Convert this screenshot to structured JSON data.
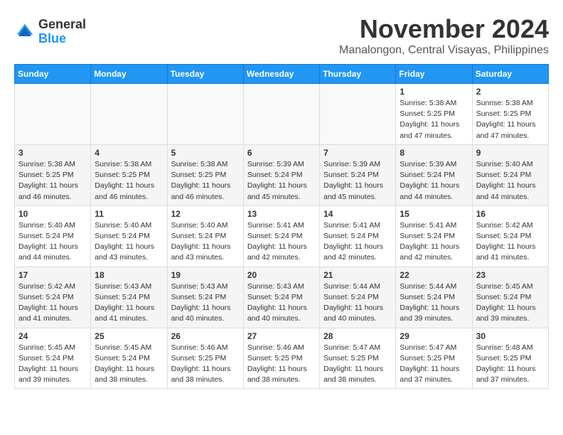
{
  "header": {
    "logo_general": "General",
    "logo_blue": "Blue",
    "month_title": "November 2024",
    "location": "Manalongon, Central Visayas, Philippines"
  },
  "weekdays": [
    "Sunday",
    "Monday",
    "Tuesday",
    "Wednesday",
    "Thursday",
    "Friday",
    "Saturday"
  ],
  "weeks": [
    [
      {
        "day": "",
        "info": ""
      },
      {
        "day": "",
        "info": ""
      },
      {
        "day": "",
        "info": ""
      },
      {
        "day": "",
        "info": ""
      },
      {
        "day": "",
        "info": ""
      },
      {
        "day": "1",
        "info": "Sunrise: 5:38 AM\nSunset: 5:25 PM\nDaylight: 11 hours and 47 minutes."
      },
      {
        "day": "2",
        "info": "Sunrise: 5:38 AM\nSunset: 5:25 PM\nDaylight: 11 hours and 47 minutes."
      }
    ],
    [
      {
        "day": "3",
        "info": "Sunrise: 5:38 AM\nSunset: 5:25 PM\nDaylight: 11 hours and 46 minutes."
      },
      {
        "day": "4",
        "info": "Sunrise: 5:38 AM\nSunset: 5:25 PM\nDaylight: 11 hours and 46 minutes."
      },
      {
        "day": "5",
        "info": "Sunrise: 5:38 AM\nSunset: 5:25 PM\nDaylight: 11 hours and 46 minutes."
      },
      {
        "day": "6",
        "info": "Sunrise: 5:39 AM\nSunset: 5:24 PM\nDaylight: 11 hours and 45 minutes."
      },
      {
        "day": "7",
        "info": "Sunrise: 5:39 AM\nSunset: 5:24 PM\nDaylight: 11 hours and 45 minutes."
      },
      {
        "day": "8",
        "info": "Sunrise: 5:39 AM\nSunset: 5:24 PM\nDaylight: 11 hours and 44 minutes."
      },
      {
        "day": "9",
        "info": "Sunrise: 5:40 AM\nSunset: 5:24 PM\nDaylight: 11 hours and 44 minutes."
      }
    ],
    [
      {
        "day": "10",
        "info": "Sunrise: 5:40 AM\nSunset: 5:24 PM\nDaylight: 11 hours and 44 minutes."
      },
      {
        "day": "11",
        "info": "Sunrise: 5:40 AM\nSunset: 5:24 PM\nDaylight: 11 hours and 43 minutes."
      },
      {
        "day": "12",
        "info": "Sunrise: 5:40 AM\nSunset: 5:24 PM\nDaylight: 11 hours and 43 minutes."
      },
      {
        "day": "13",
        "info": "Sunrise: 5:41 AM\nSunset: 5:24 PM\nDaylight: 11 hours and 42 minutes."
      },
      {
        "day": "14",
        "info": "Sunrise: 5:41 AM\nSunset: 5:24 PM\nDaylight: 11 hours and 42 minutes."
      },
      {
        "day": "15",
        "info": "Sunrise: 5:41 AM\nSunset: 5:24 PM\nDaylight: 11 hours and 42 minutes."
      },
      {
        "day": "16",
        "info": "Sunrise: 5:42 AM\nSunset: 5:24 PM\nDaylight: 11 hours and 41 minutes."
      }
    ],
    [
      {
        "day": "17",
        "info": "Sunrise: 5:42 AM\nSunset: 5:24 PM\nDaylight: 11 hours and 41 minutes."
      },
      {
        "day": "18",
        "info": "Sunrise: 5:43 AM\nSunset: 5:24 PM\nDaylight: 11 hours and 41 minutes."
      },
      {
        "day": "19",
        "info": "Sunrise: 5:43 AM\nSunset: 5:24 PM\nDaylight: 11 hours and 40 minutes."
      },
      {
        "day": "20",
        "info": "Sunrise: 5:43 AM\nSunset: 5:24 PM\nDaylight: 11 hours and 40 minutes."
      },
      {
        "day": "21",
        "info": "Sunrise: 5:44 AM\nSunset: 5:24 PM\nDaylight: 11 hours and 40 minutes."
      },
      {
        "day": "22",
        "info": "Sunrise: 5:44 AM\nSunset: 5:24 PM\nDaylight: 11 hours and 39 minutes."
      },
      {
        "day": "23",
        "info": "Sunrise: 5:45 AM\nSunset: 5:24 PM\nDaylight: 11 hours and 39 minutes."
      }
    ],
    [
      {
        "day": "24",
        "info": "Sunrise: 5:45 AM\nSunset: 5:24 PM\nDaylight: 11 hours and 39 minutes."
      },
      {
        "day": "25",
        "info": "Sunrise: 5:45 AM\nSunset: 5:24 PM\nDaylight: 11 hours and 38 minutes."
      },
      {
        "day": "26",
        "info": "Sunrise: 5:46 AM\nSunset: 5:25 PM\nDaylight: 11 hours and 38 minutes."
      },
      {
        "day": "27",
        "info": "Sunrise: 5:46 AM\nSunset: 5:25 PM\nDaylight: 11 hours and 38 minutes."
      },
      {
        "day": "28",
        "info": "Sunrise: 5:47 AM\nSunset: 5:25 PM\nDaylight: 11 hours and 38 minutes."
      },
      {
        "day": "29",
        "info": "Sunrise: 5:47 AM\nSunset: 5:25 PM\nDaylight: 11 hours and 37 minutes."
      },
      {
        "day": "30",
        "info": "Sunrise: 5:48 AM\nSunset: 5:25 PM\nDaylight: 11 hours and 37 minutes."
      }
    ]
  ]
}
